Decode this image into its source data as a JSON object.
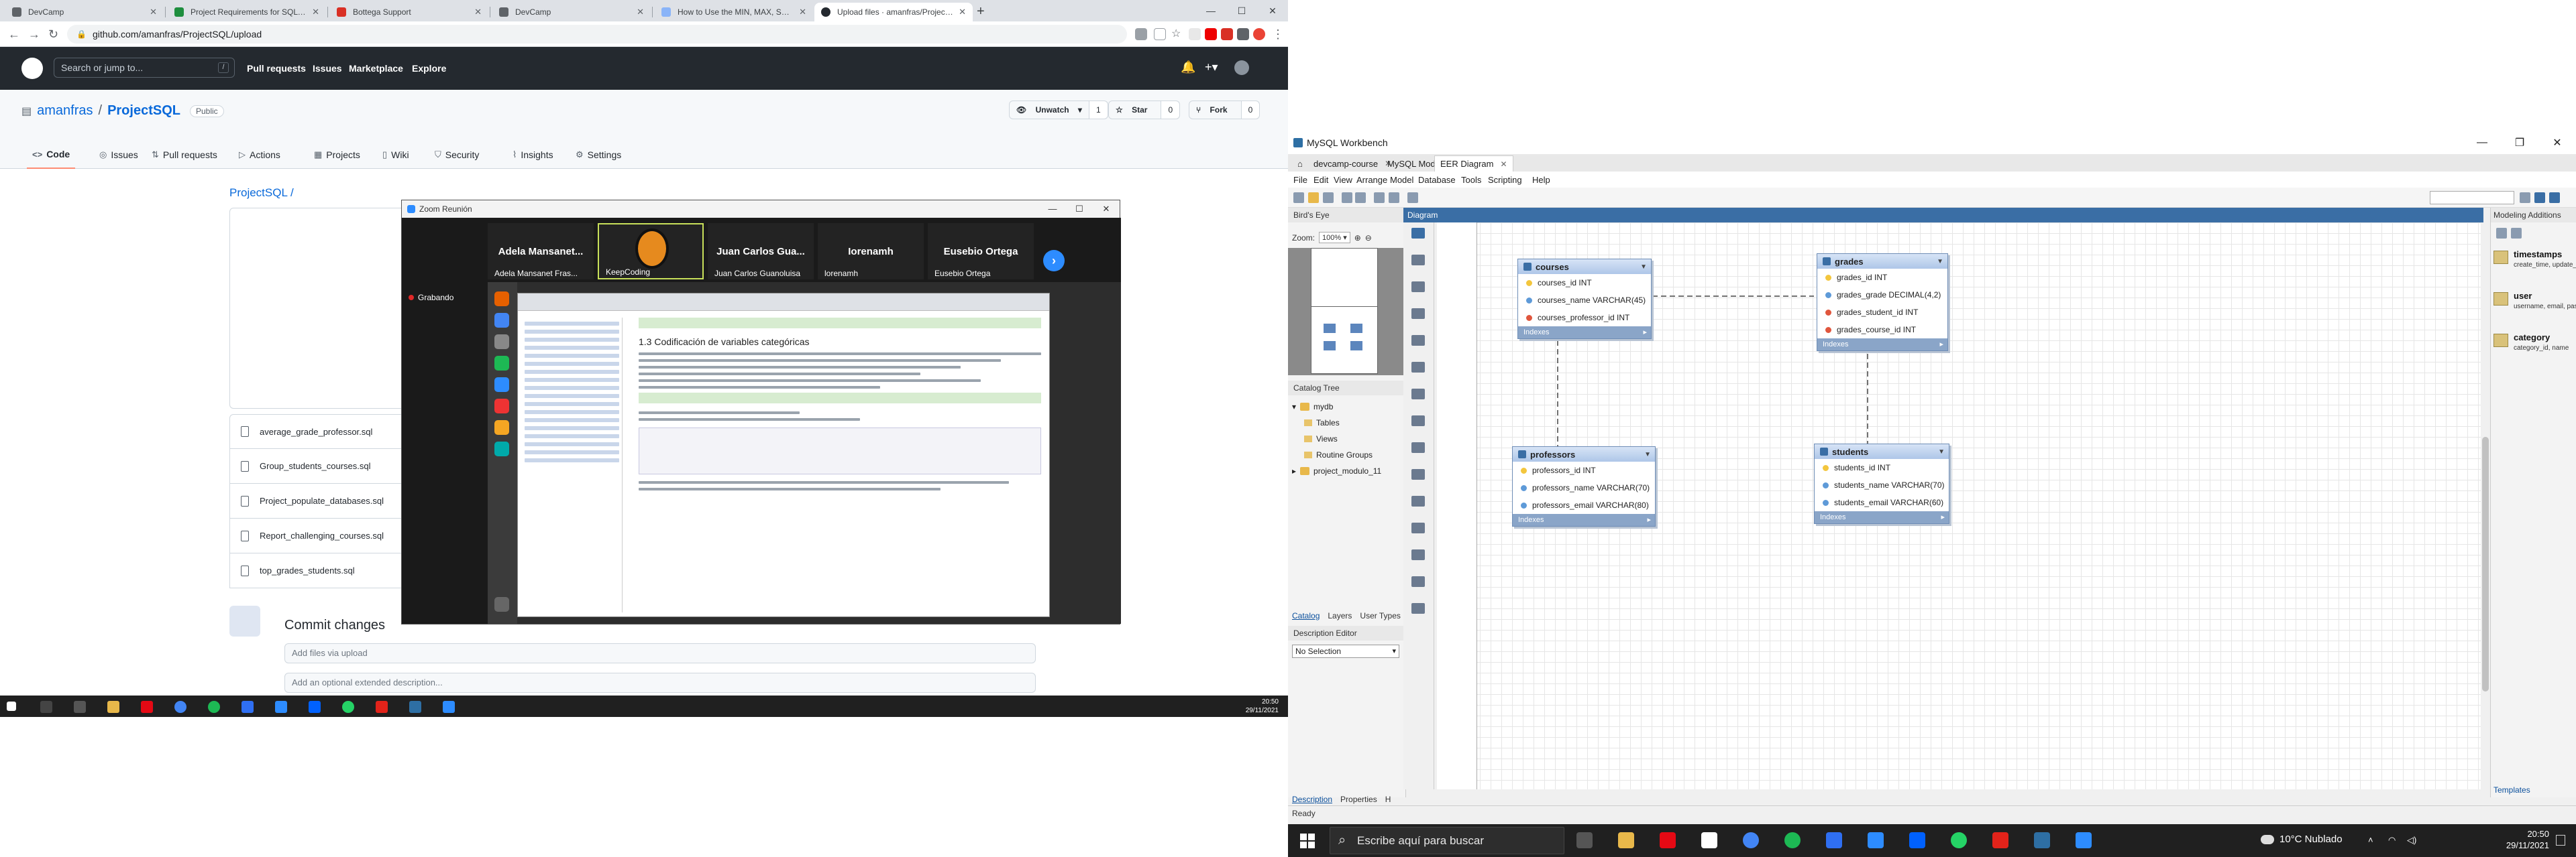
{
  "chrome": {
    "tabs": [
      {
        "title": "DevCamp"
      },
      {
        "title": "Project Requirements for SQL C..."
      },
      {
        "title": "Bottega Support"
      },
      {
        "title": "DevCamp"
      },
      {
        "title": "How to Use the MIN, MAX, SUM..."
      },
      {
        "title": "Upload files · amanfras/ProjectS..."
      }
    ],
    "active_tab": 5,
    "url": "github.com/amanfras/ProjectSQL/upload"
  },
  "github": {
    "search_placeholder": "Search or jump to...",
    "search_key": "/",
    "nav": [
      "Pull requests",
      "Issues",
      "Marketplace",
      "Explore"
    ],
    "owner": "amanfras",
    "repo": "ProjectSQL",
    "visibility": "Public",
    "unwatch_label": "Unwatch",
    "unwatch_count": "1",
    "star_label": "Star",
    "star_count": "0",
    "fork_label": "Fork",
    "fork_count": "0",
    "repo_tabs": [
      "Code",
      "Issues",
      "Pull requests",
      "Actions",
      "Projects",
      "Wiki",
      "Security",
      "Insights",
      "Settings"
    ],
    "breadcrumb": "ProjectSQL /",
    "files": [
      "average_grade_professor.sql",
      "Group_students_courses.sql",
      "Project_populate_databases.sql",
      "Report_challenging_courses.sql",
      "top_grades_students.sql"
    ],
    "commit_title": "Commit changes",
    "commit_placeholder": "Add files via upload",
    "description_placeholder": "Add an optional extended description..."
  },
  "zoom": {
    "title": "Zoom Reunión",
    "participants": [
      {
        "big": "Adela Mansanet...",
        "small": "Adela Mansanet Fras..."
      },
      {
        "big": "",
        "small": "KeepCoding"
      },
      {
        "big": "Juan Carlos Gua...",
        "small": "Juan Carlos Guanoluisa"
      },
      {
        "big": "Iorenamh",
        "small": "lorenamh"
      },
      {
        "big": "Eusebio Ortega",
        "small": "Eusebio Ortega"
      }
    ],
    "recording_label": "Grabando",
    "notebook_heading": "1.3 Codificación de variables categóricas"
  },
  "left_taskbar": {
    "time": "20:50",
    "date": "29/11/2021"
  },
  "workbench": {
    "window_title": "MySQL Workbench",
    "tabs": [
      "devcamp-course",
      "MySQL Model*",
      "EER Diagram"
    ],
    "menu": [
      "File",
      "Edit",
      "View",
      "Arrange",
      "Model",
      "Database",
      "Tools",
      "Scripting",
      "Help"
    ],
    "birds_eye_label": "Bird's Eye",
    "zoom_label": "Zoom:",
    "zoom_value": "100%",
    "catalog_tree_label": "Catalog Tree",
    "tree": {
      "schema1": "mydb",
      "children": [
        "Tables",
        "Views",
        "Routine Groups"
      ],
      "schema2": "project_modulo_11"
    },
    "catalog_tabs": [
      "Catalog",
      "Layers",
      "User Types"
    ],
    "description_editor_label": "Description Editor",
    "description_select": "No Selection",
    "bottom_tabs": [
      "Description",
      "Properties",
      "H"
    ],
    "diagram_label": "Diagram",
    "modeling_label": "Modeling Additions",
    "modeling_items": [
      {
        "title": "timestamps",
        "desc": "create_time, update_time"
      },
      {
        "title": "user",
        "desc": "username, email, passwor..."
      },
      {
        "title": "category",
        "desc": "category_id, name"
      }
    ],
    "templates_label": "Templates",
    "status": "Ready",
    "entities": {
      "courses": {
        "name": "courses",
        "cols": [
          "courses_id INT",
          "courses_name VARCHAR(45)",
          "courses_professor_id INT"
        ],
        "indexes": "Indexes"
      },
      "grades": {
        "name": "grades",
        "cols": [
          "grades_id INT",
          "grades_grade DECIMAL(4,2)",
          "grades_student_id INT",
          "grades_course_id INT"
        ],
        "indexes": "Indexes"
      },
      "professors": {
        "name": "professors",
        "cols": [
          "professors_id INT",
          "professors_name VARCHAR(70)",
          "professors_email VARCHAR(80)"
        ],
        "indexes": "Indexes"
      },
      "students": {
        "name": "students",
        "cols": [
          "students_id INT",
          "students_name VARCHAR(70)",
          "students_email VARCHAR(60)"
        ],
        "indexes": "Indexes"
      }
    }
  },
  "right_taskbar": {
    "search_placeholder": "Escribe aquí para buscar",
    "weather": "10°C Nublado",
    "time": "20:50",
    "date": "29/11/2021"
  }
}
